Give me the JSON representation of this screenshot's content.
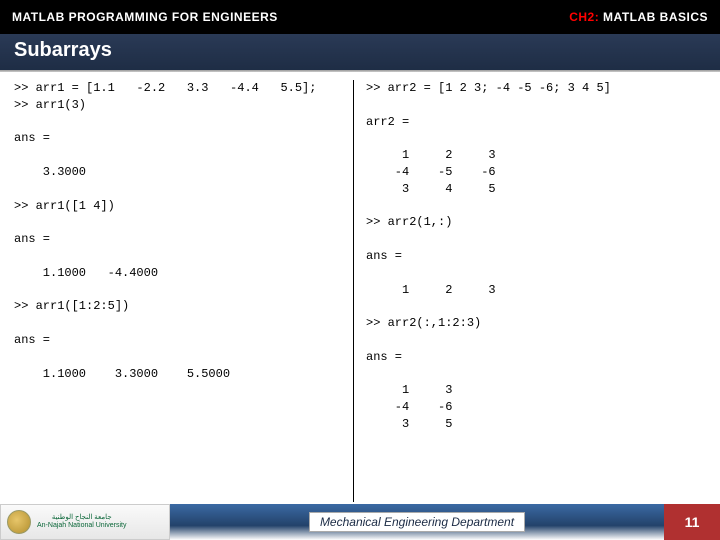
{
  "header": {
    "left": "MATLAB PROGRAMMING FOR ENGINEERS",
    "chapter_prefix": "CH2:",
    "chapter_title": " MATLAB BASICS"
  },
  "title": "Subarrays",
  "code": {
    "left": ">> arr1 = [1.1   -2.2   3.3   -4.4   5.5];\n>> arr1(3)\n\nans =\n\n    3.3000\n\n>> arr1([1 4])\n\nans =\n\n    1.1000   -4.4000\n\n>> arr1([1:2:5])\n\nans =\n\n    1.1000    3.3000    5.5000",
    "right": ">> arr2 = [1 2 3; -4 -5 -6; 3 4 5]\n\narr2 =\n\n     1     2     3\n    -4    -5    -6\n     3     4     5\n\n>> arr2(1,:)\n\nans =\n\n     1     2     3\n\n>> arr2(:,1:2:3)\n\nans =\n\n     1     3\n    -4    -6\n     3     5"
  },
  "footer": {
    "university_ar": "جامعة النجاح الوطنية",
    "university_en": "An-Najah National University",
    "department": "Mechanical Engineering Department",
    "page": "11"
  }
}
